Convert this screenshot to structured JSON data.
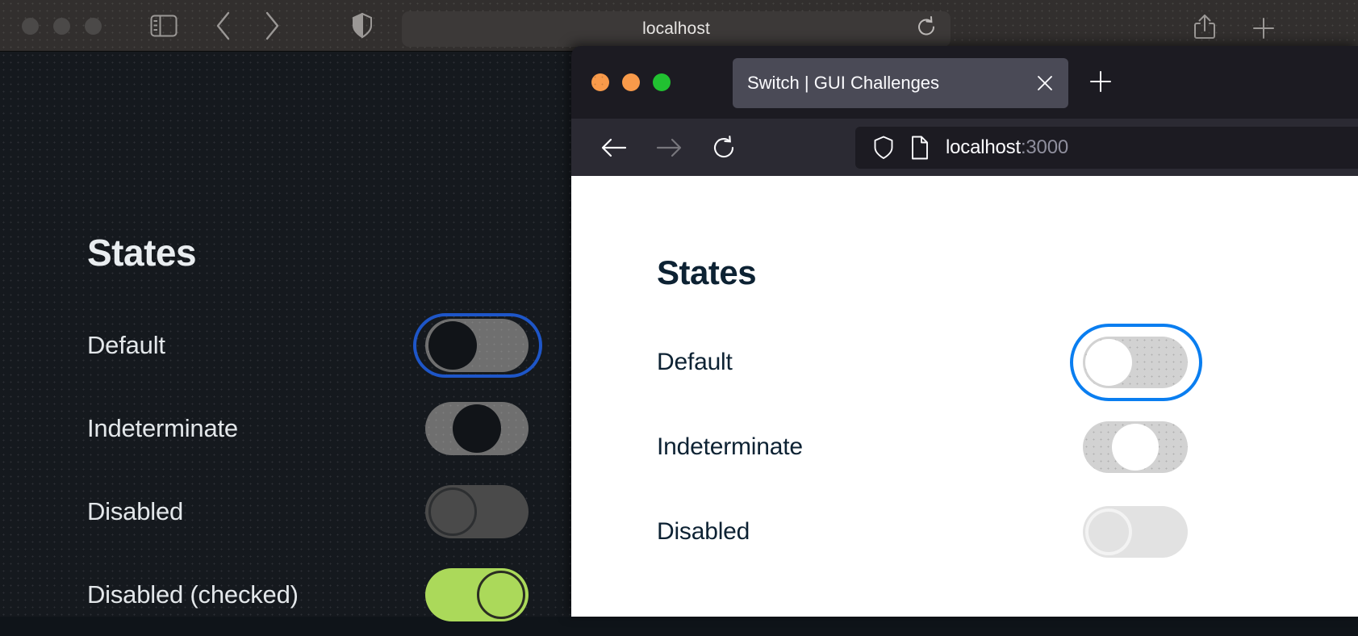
{
  "safari": {
    "window_name": "Safari",
    "urlbar": {
      "text": "localhost"
    },
    "icons": {
      "sidebar": "sidebar-icon",
      "back": "back-arrow-icon",
      "forward": "forward-arrow-icon",
      "shield": "shield-icon",
      "reload": "reload-icon",
      "share": "share-icon",
      "new_tab": "plus-icon"
    },
    "page": {
      "heading": "States",
      "rows": [
        {
          "label": "Default",
          "state": "off",
          "focused": true,
          "disabled": false
        },
        {
          "label": "Indeterminate",
          "state": "indeterminate",
          "focused": false,
          "disabled": false
        },
        {
          "label": "Disabled",
          "state": "off",
          "focused": false,
          "disabled": true
        },
        {
          "label": "Disabled (checked)",
          "state": "on",
          "focused": false,
          "disabled": true
        }
      ]
    },
    "colors": {
      "toolbar_bg": "#322f2e",
      "page_bg": "#15191e",
      "focus_ring": "#1e56c8",
      "track": "#6f6f6f",
      "thumb": "#111418",
      "checked_track": "#abd95a",
      "text": "#e9edf0"
    }
  },
  "firefox": {
    "window_name": "Firefox",
    "tab": {
      "title": "Switch | GUI Challenges",
      "close_label": "×"
    },
    "new_tab_label": "+",
    "urlbar": {
      "host": "localhost",
      "port": ":3000"
    },
    "icons": {
      "back": "back-arrow-icon",
      "forward": "forward-arrow-icon",
      "reload": "reload-icon",
      "shield": "shield-icon",
      "page": "page-document-icon",
      "close_tab": "close-icon",
      "new_tab": "plus-icon"
    },
    "page": {
      "heading": "States",
      "rows": [
        {
          "label": "Default",
          "state": "off",
          "focused": true,
          "disabled": false
        },
        {
          "label": "Indeterminate",
          "state": "indeterminate",
          "focused": false,
          "disabled": false
        },
        {
          "label": "Disabled",
          "state": "off",
          "focused": false,
          "disabled": true
        }
      ]
    },
    "colors": {
      "tabbar_bg": "#1c1b22",
      "navbar_bg": "#2b2a33",
      "tab_active_bg": "#4a4a56",
      "page_bg": "#ffffff",
      "focus_ring": "#0a7ef0",
      "track": "#d2d2d2",
      "thumb": "#ffffff",
      "text": "#0d2233"
    }
  }
}
